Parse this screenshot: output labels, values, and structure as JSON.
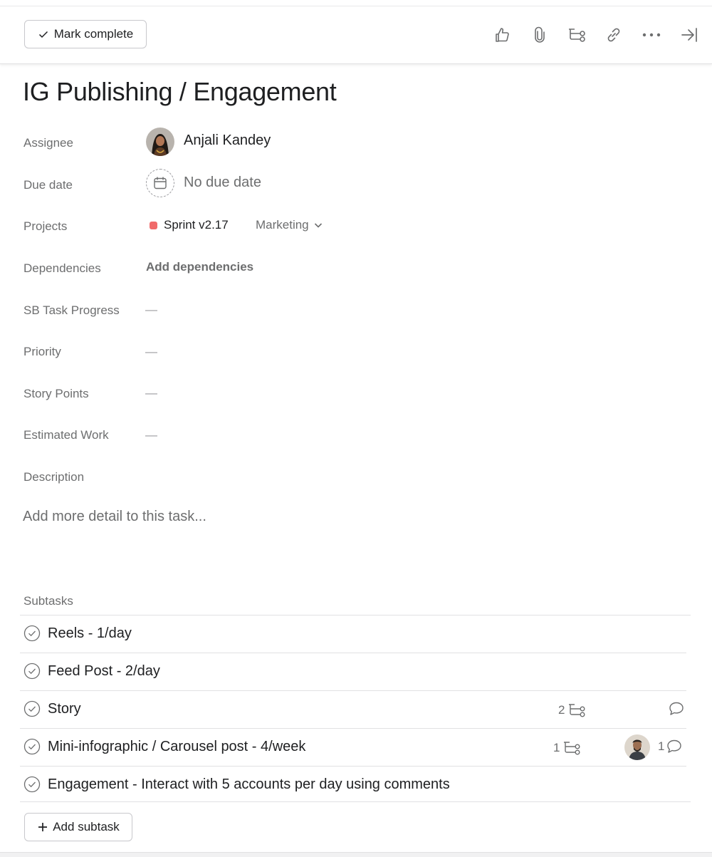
{
  "toolbar": {
    "mark_complete_label": "Mark complete",
    "icons": [
      "thumbs-up-icon",
      "paperclip-icon",
      "subtask-icon",
      "link-icon",
      "more-icon",
      "close-pane-icon"
    ]
  },
  "task": {
    "title": "IG Publishing / Engagement",
    "fields": {
      "assignee": {
        "label": "Assignee",
        "value": "Anjali Kandey"
      },
      "due_date": {
        "label": "Due date",
        "value": "No due date"
      },
      "projects": {
        "label": "Projects",
        "project_name": "Sprint v2.17",
        "project_color": "#f06a6a",
        "section": "Marketing"
      },
      "dependencies": {
        "label": "Dependencies",
        "action": "Add dependencies"
      },
      "sb_task_progress": {
        "label": "SB Task Progress",
        "value": "—"
      },
      "priority": {
        "label": "Priority",
        "value": "—"
      },
      "story_points": {
        "label": "Story Points",
        "value": "—"
      },
      "estimated_work": {
        "label": "Estimated Work",
        "value": "—"
      },
      "description": {
        "label": "Description",
        "placeholder": "Add more detail to this task..."
      }
    }
  },
  "subtasks": {
    "header": "Subtasks",
    "items": [
      {
        "name": "Reels - 1/day"
      },
      {
        "name": "Feed Post - 2/day"
      },
      {
        "name": "Story",
        "subtask_count": "2"
      },
      {
        "name": "Mini-infographic / Carousel post - 4/week",
        "subtask_count": "1",
        "comment_count": "1"
      },
      {
        "name": "Engagement - Interact with 5 accounts per day using comments"
      }
    ],
    "add_label": "Add subtask"
  }
}
